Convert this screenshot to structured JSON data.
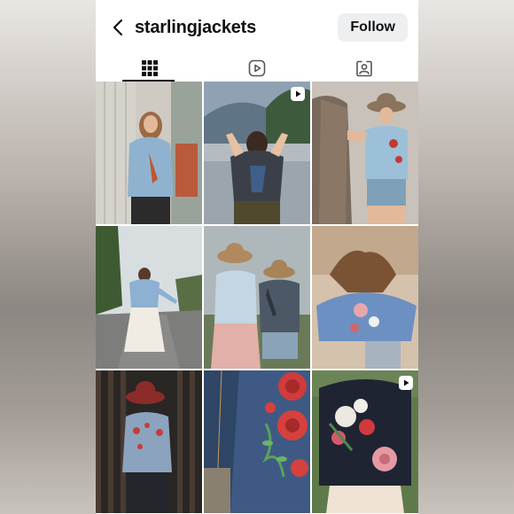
{
  "profile": {
    "username": "starlingjackets",
    "follow_label": "Follow"
  },
  "tabs": [
    {
      "name": "grid",
      "icon": "grid-icon",
      "active": true
    },
    {
      "name": "reels",
      "icon": "reels-icon",
      "active": false
    },
    {
      "name": "tagged",
      "icon": "tagged-icon",
      "active": false
    }
  ],
  "posts": [
    {
      "id": "post-1",
      "is_reel": false
    },
    {
      "id": "post-2",
      "is_reel": true
    },
    {
      "id": "post-3",
      "is_reel": false
    },
    {
      "id": "post-4",
      "is_reel": false
    },
    {
      "id": "post-5",
      "is_reel": false
    },
    {
      "id": "post-6",
      "is_reel": false
    },
    {
      "id": "post-7",
      "is_reel": false
    },
    {
      "id": "post-8",
      "is_reel": false
    },
    {
      "id": "post-9",
      "is_reel": true
    }
  ],
  "colors": {
    "text": "#111111",
    "follow_bg": "#eeeff1",
    "icon": "#262626"
  }
}
